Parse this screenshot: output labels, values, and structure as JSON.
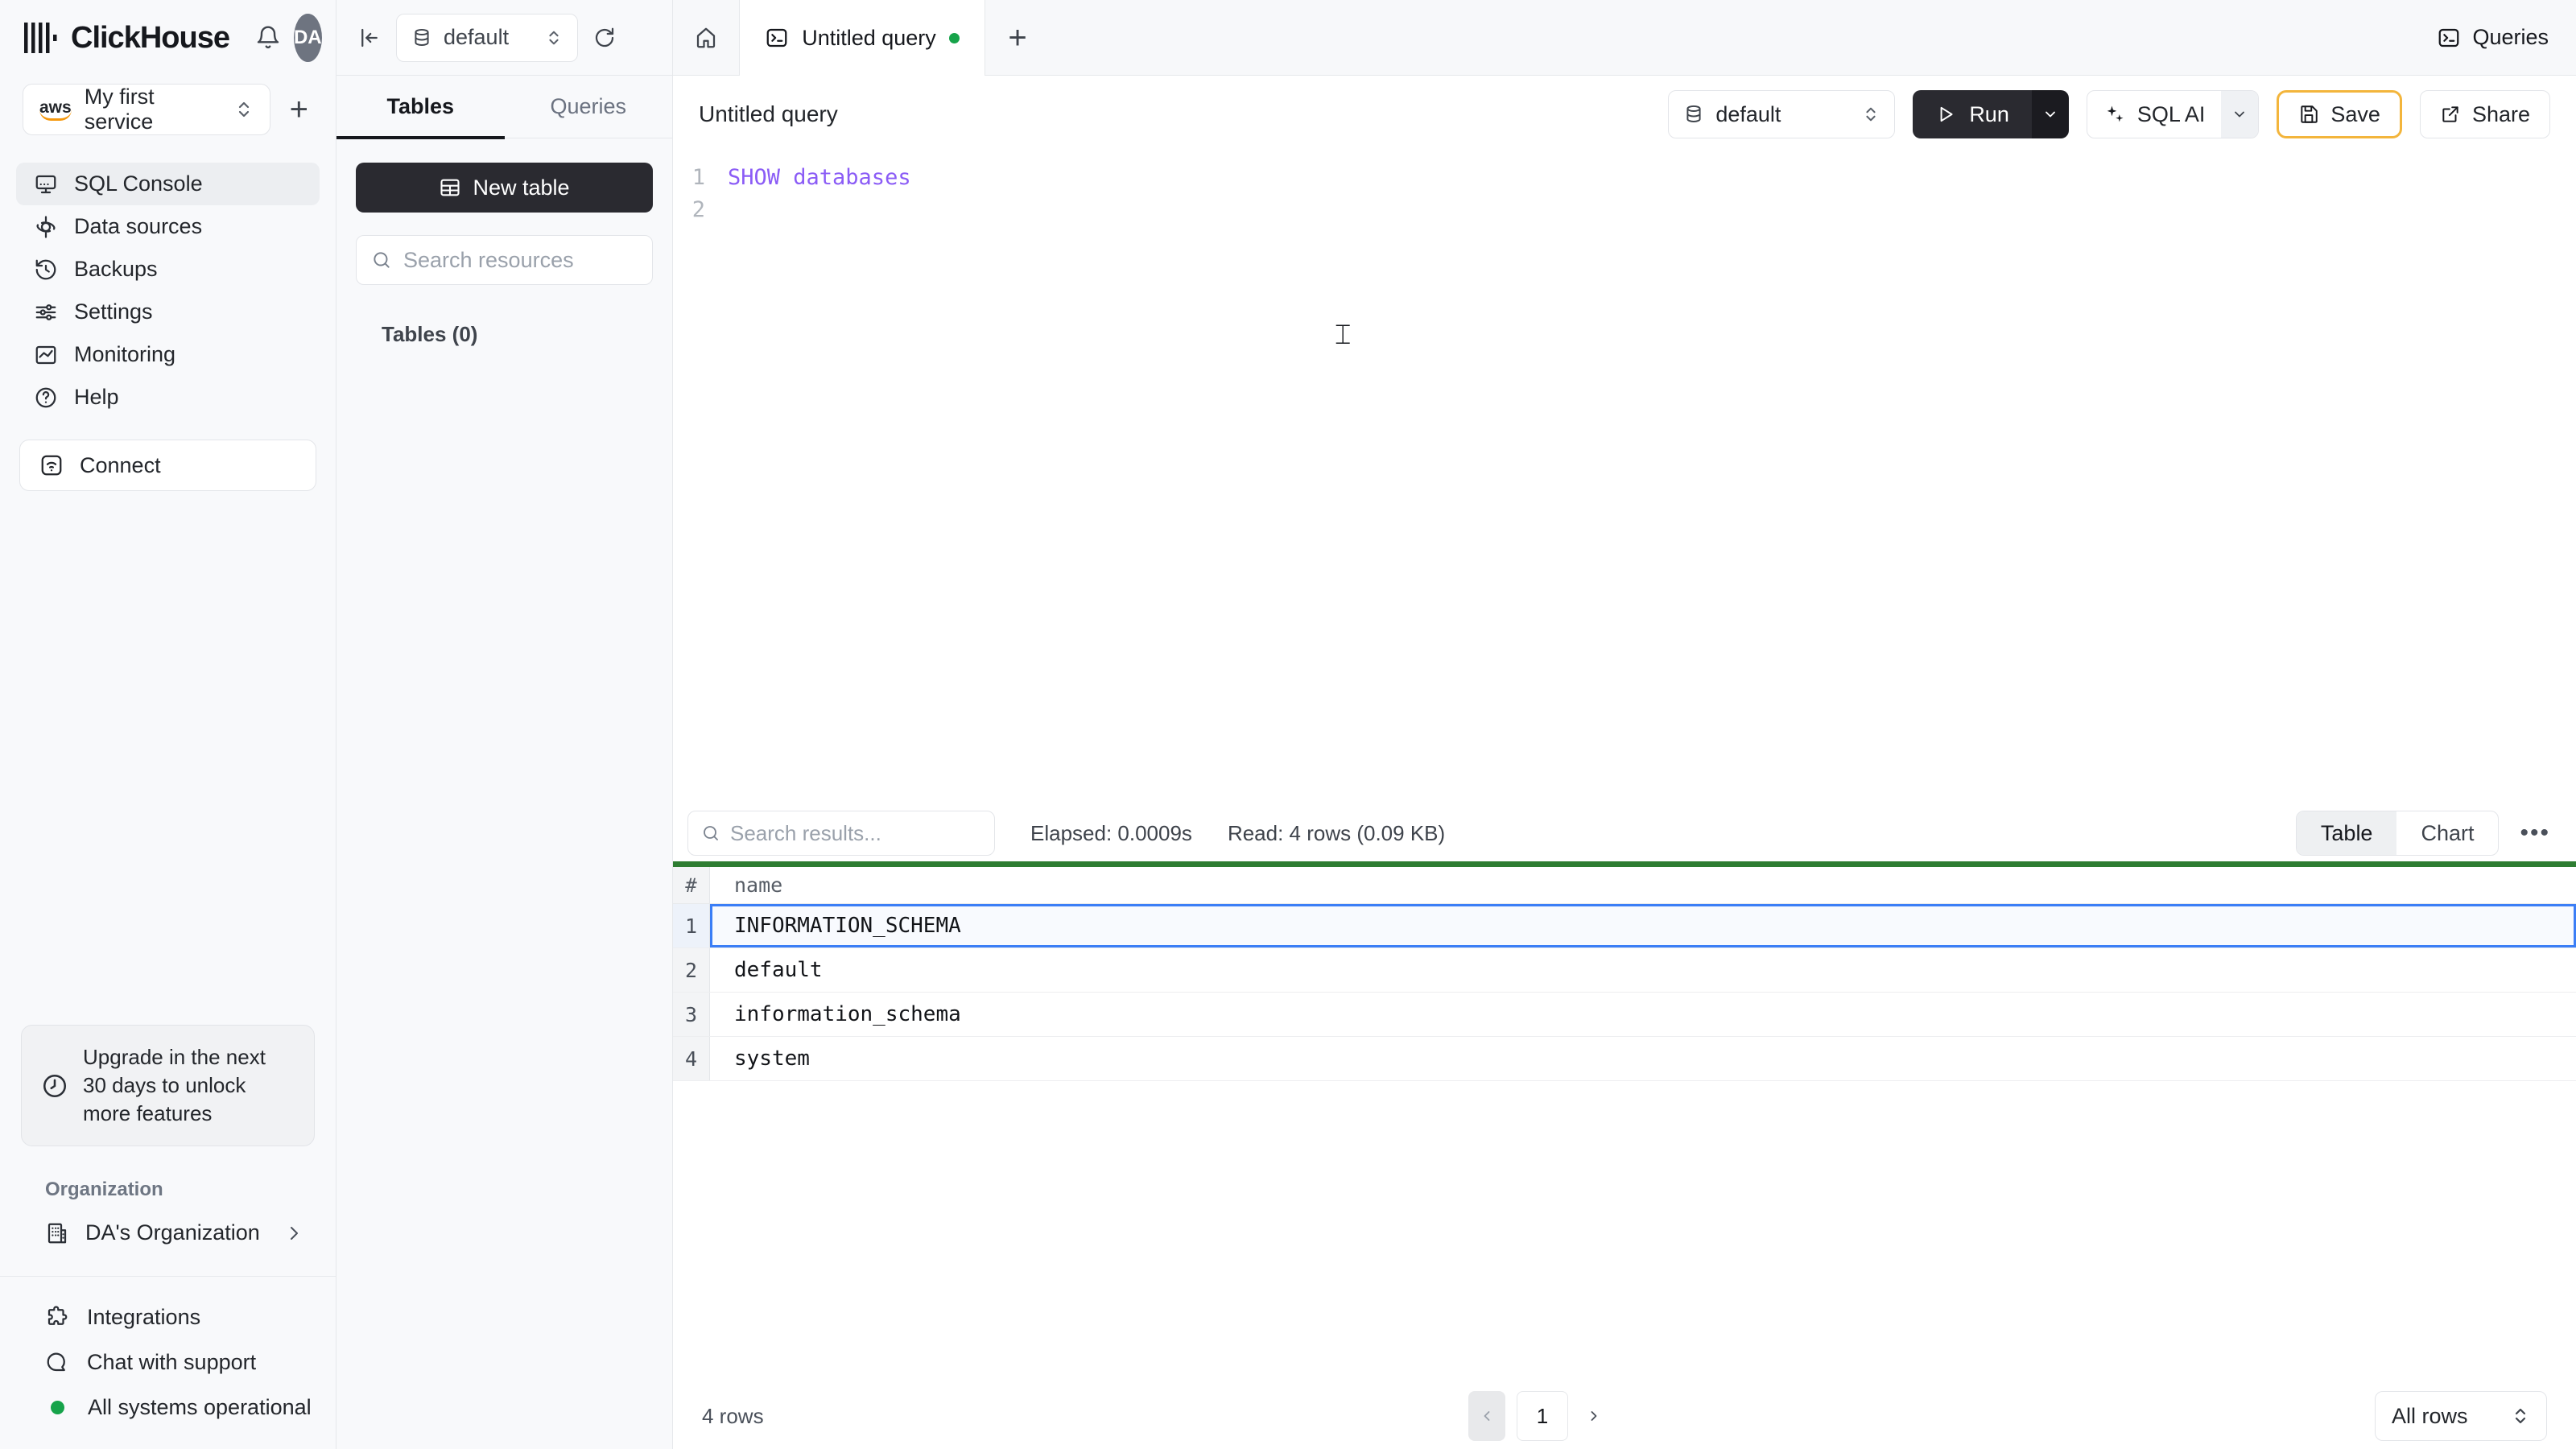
{
  "colors": {
    "accent-green": "#16A34A",
    "success-bar": "#2E7D32",
    "selection-blue": "#3B7EF6",
    "sql-purple": "#8B5CF6",
    "save-border-yellow": "#F3B53C",
    "dark-button": "#2A2A30",
    "dark-button-darker": "#1B1B20",
    "aws-orange": "#F5980D"
  },
  "sidebar": {
    "brand": "ClickHouse",
    "avatar_initials": "DA",
    "service_selector": {
      "aws_mark": "aws",
      "label": "My first service"
    },
    "nav": [
      {
        "label": "SQL Console"
      },
      {
        "label": "Data sources"
      },
      {
        "label": "Backups"
      },
      {
        "label": "Settings"
      },
      {
        "label": "Monitoring"
      },
      {
        "label": "Help"
      }
    ],
    "connect_label": "Connect",
    "upgrade_notice": "Upgrade in the next 30 days to unlock more features",
    "organization": {
      "section_label": "Organization",
      "name": "DA's Organization"
    },
    "footer": {
      "integrations": "Integrations",
      "chat": "Chat with support",
      "status": "All systems operational"
    }
  },
  "explorer": {
    "database_selector": "default",
    "tabs": [
      {
        "label": "Tables"
      },
      {
        "label": "Queries"
      }
    ],
    "new_table_label": "New table",
    "search_placeholder": "Search resources",
    "tables_count_label": "Tables (0)"
  },
  "tabstrip": {
    "active_tab": "Untitled query",
    "queries_label": "Queries"
  },
  "query_editor": {
    "title": "Untitled query",
    "database_selector": "default",
    "run_label": "Run",
    "sql_ai_label": "SQL AI",
    "save_label": "Save",
    "share_label": "Share",
    "lines": [
      {
        "number": "1",
        "code": "SHOW databases"
      },
      {
        "number": "2",
        "code": ""
      }
    ]
  },
  "results": {
    "search_placeholder": "Search results...",
    "elapsed_label": "Elapsed: 0.0009s",
    "read_label": "Read: 4 rows (0.09 KB)",
    "view_toggle": {
      "table": "Table",
      "chart": "Chart"
    },
    "table": {
      "columns": {
        "num": "#",
        "name": "name"
      },
      "rows": [
        {
          "num": "1",
          "name": "INFORMATION_SCHEMA"
        },
        {
          "num": "2",
          "name": "default"
        },
        {
          "num": "3",
          "name": "information_schema"
        },
        {
          "num": "4",
          "name": "system"
        }
      ]
    },
    "footer": {
      "rows_label": "4 rows",
      "page": "1",
      "page_size_label": "All rows"
    }
  }
}
